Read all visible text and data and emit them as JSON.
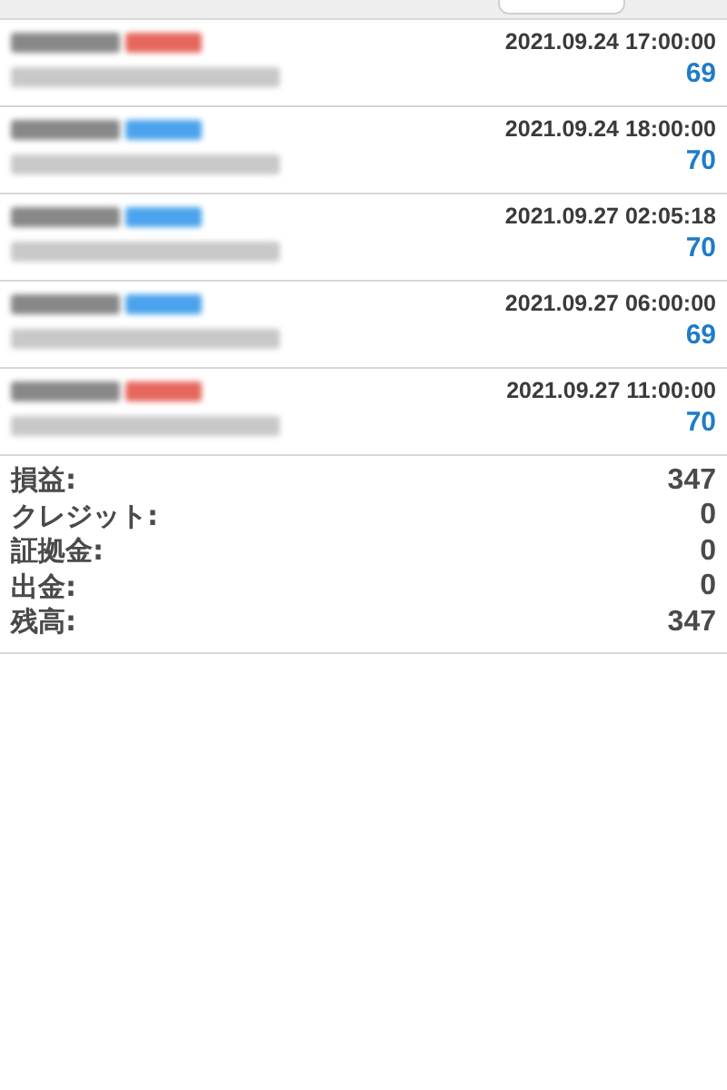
{
  "trades": [
    {
      "color": "#e5675d",
      "time": "2021.09.24 17:00:00",
      "profit": "69"
    },
    {
      "color": "#4aa3ec",
      "time": "2021.09.24 18:00:00",
      "profit": "70"
    },
    {
      "color": "#4aa3ec",
      "time": "2021.09.27 02:05:18",
      "profit": "70"
    },
    {
      "color": "#4aa3ec",
      "time": "2021.09.27 06:00:00",
      "profit": "69"
    },
    {
      "color": "#e5675d",
      "time": "2021.09.27 11:00:00",
      "profit": "70"
    }
  ],
  "summary": [
    {
      "label": "損益:",
      "value": "347"
    },
    {
      "label": "クレジット:",
      "value": "0"
    },
    {
      "label": "証拠金:",
      "value": "0"
    },
    {
      "label": "出金:",
      "value": "0"
    },
    {
      "label": "残高:",
      "value": "347"
    }
  ]
}
